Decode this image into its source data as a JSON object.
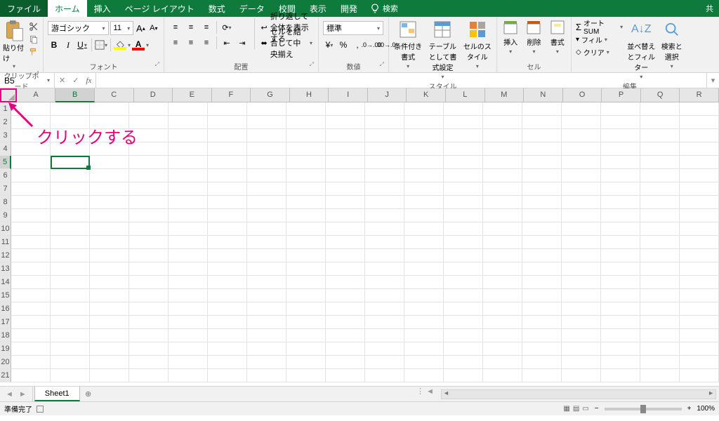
{
  "tabs": {
    "file": "ファイル",
    "home": "ホーム",
    "insert": "挿入",
    "layout": "ページ レイアウト",
    "formulas": "数式",
    "data": "データ",
    "review": "校閲",
    "view": "表示",
    "developer": "開発",
    "search": "検索",
    "share": "共"
  },
  "clipboard": {
    "paste": "貼り付け",
    "label": "クリップボード"
  },
  "font": {
    "name": "游ゴシック",
    "size": "11",
    "bold": "B",
    "italic": "I",
    "underline": "U",
    "increase": "A",
    "decrease": "A",
    "label": "フォント"
  },
  "align": {
    "wrap": "折り返して全体を表示する",
    "merge": "セルを結合して中央揃え",
    "label": "配置"
  },
  "number": {
    "format": "標準",
    "label": "数値"
  },
  "styles": {
    "cond": "条件付き書式",
    "table": "テーブルとして書式設定",
    "cell": "セルのスタイル",
    "label": "スタイル"
  },
  "cells": {
    "insert": "挿入",
    "delete": "削除",
    "format": "書式",
    "label": "セル"
  },
  "editing": {
    "autosum": "オート SUM",
    "fill": "フィル",
    "clear": "クリア",
    "sort": "並べ替えとフィルター",
    "find": "検索と選択",
    "label": "編集"
  },
  "formula_bar": {
    "name_box": "B5",
    "fx": "fx"
  },
  "columns": [
    "A",
    "B",
    "C",
    "D",
    "E",
    "F",
    "G",
    "H",
    "I",
    "J",
    "K",
    "L",
    "M",
    "N",
    "O",
    "P",
    "Q",
    "R"
  ],
  "rows": [
    "1",
    "2",
    "3",
    "4",
    "5",
    "6",
    "7",
    "8",
    "9",
    "10",
    "11",
    "12",
    "13",
    "14",
    "15",
    "16",
    "17",
    "18",
    "19",
    "20",
    "21"
  ],
  "selected": {
    "col": "B",
    "row": "5"
  },
  "annotation": {
    "text": "クリックする"
  },
  "sheet": {
    "name": "Sheet1",
    "status": "準備完了",
    "zoom": "100%"
  }
}
